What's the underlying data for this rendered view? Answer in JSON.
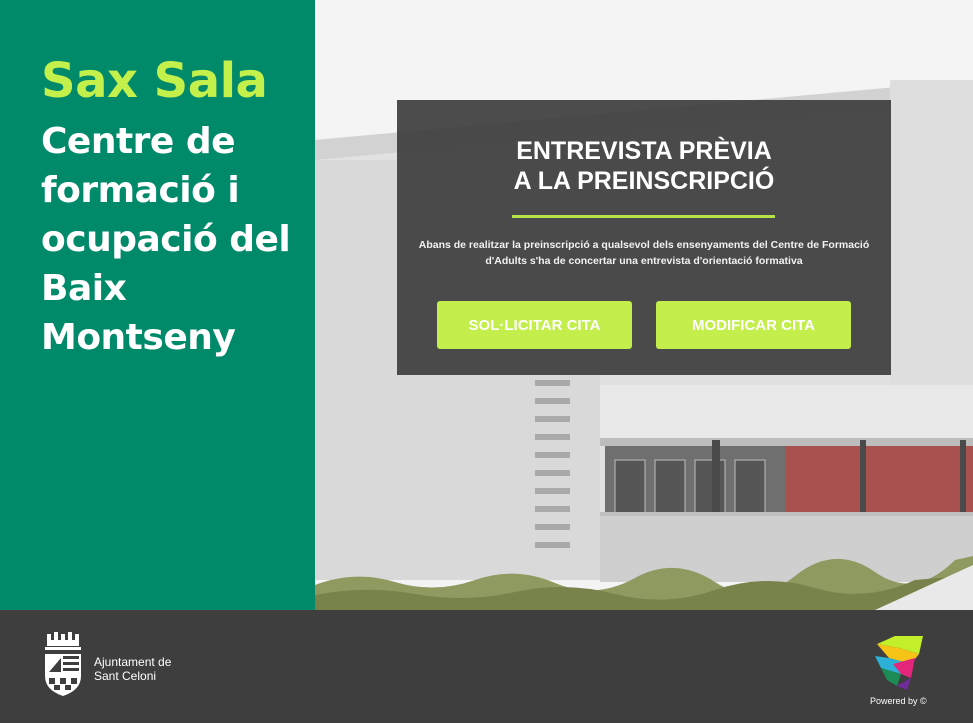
{
  "brand": {
    "title": "Sax Sala",
    "subtitle": "Centre de formació i ocupació del Baix Montseny"
  },
  "card": {
    "title_line1": "ENTREVISTA PRÈVIA",
    "title_line2": "A LA PREINSCRIPCIÓ",
    "description": "Abans de realitzar la preinscripció a qualsevol dels ensenyaments del Centre de Formació d'Adults s'ha de concertar una entrevista d'orientació formativa",
    "request_button": "SOL·LICITAR CITA",
    "modify_button": "MODIFICAR CITA"
  },
  "footer": {
    "org_line1": "Ajuntament de",
    "org_line2": "Sant Celoni",
    "powered_by": "Powered by ©"
  },
  "colors": {
    "primary_green": "#008a6a",
    "accent_lime": "#c3ee4c",
    "footer_bg": "#3e3e3e"
  },
  "icons": {
    "crest": "municipal-crest-icon",
    "logo": "multicolor-map-logo-icon"
  }
}
